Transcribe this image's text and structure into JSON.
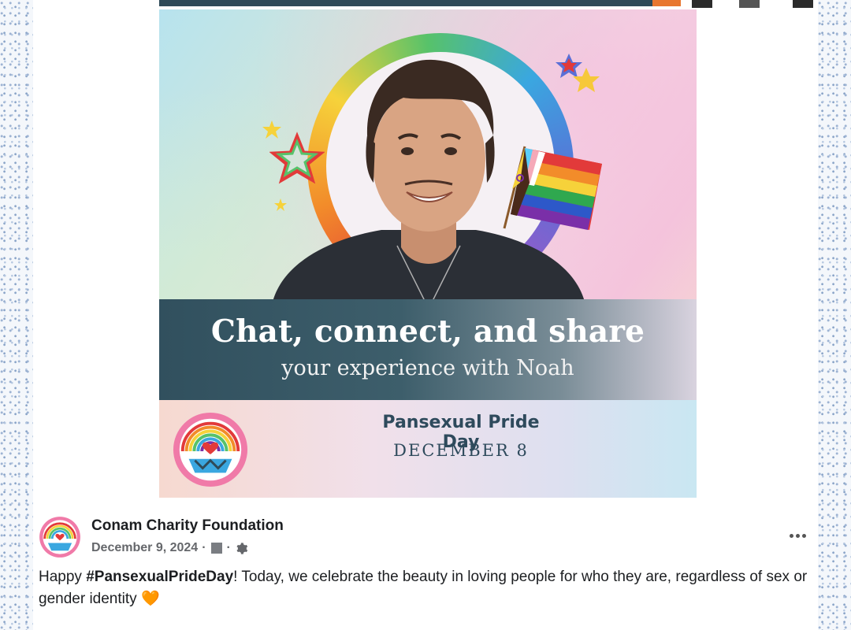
{
  "image": {
    "banner_title": "Chat, connect, and share",
    "banner_subtitle": "your experience with Noah",
    "event_title": "Pansexual Pride Day",
    "event_date": "DECEMBER 8"
  },
  "post": {
    "page_name": "Conam Charity Foundation",
    "date": "December 9, 2024",
    "separator": "·",
    "text_before": "Happy ",
    "hashtag": "#PansexualPrideDay",
    "text_after": "! Today, we celebrate the beauty in loving people for who they are, regardless of sex or gender identity",
    "emoji": "🧡"
  },
  "icons": {
    "privacy": "gear-icon",
    "audience": "square-icon",
    "more": "more-options-icon",
    "logo": "conam-logo"
  },
  "colors": {
    "banner": "#31505e",
    "event_text": "#2e4a5c",
    "meta": "#65676b",
    "text": "#1c1e21"
  }
}
